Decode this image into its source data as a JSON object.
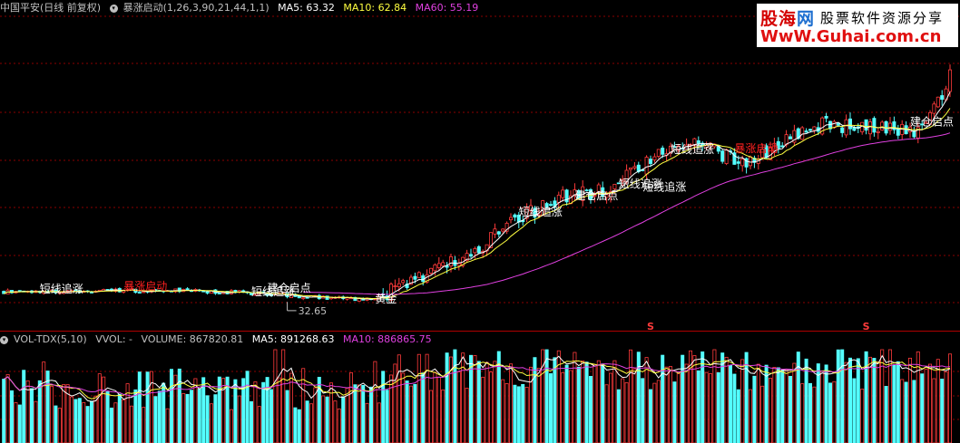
{
  "main_header": {
    "stock": "中国平安(日线 前复权)",
    "indicator": "暴涨启动(1,26,3,90,21,44,1,1)",
    "ma5": "MA5: 63.32",
    "ma10": "MA10: 62.84",
    "ma60": "MA60: 55.19"
  },
  "vol_header": {
    "indicator": "VOL-TDX(5,10)",
    "vvol": "VVOL: -",
    "volume": "VOLUME: 867820.81",
    "ma5": "MA5: 891268.63",
    "ma10": "MA10: 886865.75"
  },
  "logo": {
    "line1_a": "股海",
    "line1_b": "网",
    "line1_c": "股票软件资源分享",
    "line2": "WwW.Guhai.com.cn"
  },
  "colors": {
    "up": "#ff3b3b",
    "down": "#54ffff",
    "ma5": "#ffffff",
    "ma10": "#ffff40",
    "ma60": "#e040e0",
    "grid": "#8b0000",
    "signal_label": "#ffffff",
    "burst_label": "#ff2020"
  },
  "chart_data": {
    "type": "candlestick",
    "price_range": [
      28,
      74
    ],
    "low_marker": "32.65",
    "annotations": [
      {
        "text": "短线追涨",
        "bar": 9,
        "price": 33.0,
        "kind": "signal"
      },
      {
        "text": "暴涨启动",
        "bar": 30,
        "price": 33.4,
        "kind": "burst"
      },
      {
        "text": "短线追涨",
        "bar": 62,
        "price": 32.6,
        "kind": "signal"
      },
      {
        "text": "建仓启点",
        "bar": 66,
        "price": 33.1,
        "kind": "signal"
      },
      {
        "text": "黄金",
        "bar": 93,
        "price": 31.5,
        "kind": "signal"
      },
      {
        "text": "短线追涨",
        "bar": 129,
        "price": 44.4,
        "kind": "signal"
      },
      {
        "text": "建仓启点",
        "bar": 143,
        "price": 46.8,
        "kind": "signal"
      },
      {
        "text": "短线追涨",
        "bar": 154,
        "price": 48.6,
        "kind": "signal"
      },
      {
        "text": "短线追涨",
        "bar": 160,
        "price": 48.1,
        "kind": "signal"
      },
      {
        "text": "短线追涨",
        "bar": 167,
        "price": 53.7,
        "kind": "signal"
      },
      {
        "text": "暴涨启动",
        "bar": 183,
        "price": 53.8,
        "kind": "burst"
      },
      {
        "text": "建仓启点",
        "bar": 227,
        "price": 57.8,
        "kind": "signal"
      }
    ],
    "s_markers": [
      {
        "text": "S",
        "bar": 162
      },
      {
        "text": "S",
        "bar": 216
      }
    ]
  }
}
